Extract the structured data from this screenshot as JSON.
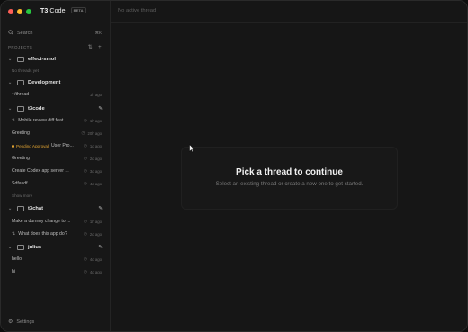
{
  "colors": {
    "close": "#fe5f57",
    "minimize": "#febc2e",
    "maximize": "#28c840",
    "pending": "#e2a432"
  },
  "app": {
    "title_brand": "T3",
    "title_rest": "Code",
    "badge": "BETA"
  },
  "search": {
    "label": "Search",
    "shortcut": "⌘K"
  },
  "projects_header": {
    "label": "PROJECTS"
  },
  "projects": [
    {
      "name": "effect-smol",
      "threads": [],
      "empty_text": "No threads yet"
    },
    {
      "name": "Development",
      "threads": [
        {
          "title": "~/thread",
          "time": "1h ago"
        }
      ]
    },
    {
      "name": "t3code",
      "threads": [
        {
          "title": "Mobile review diff feat...",
          "time": "1h ago",
          "branch": true
        },
        {
          "title": "Greeting",
          "time": "20h ago"
        },
        {
          "title": "User Pro...",
          "time": "1d ago",
          "pending": "Pending Approval"
        },
        {
          "title": "Greeting",
          "time": "2d ago"
        },
        {
          "title": "Create Codex app server ...",
          "time": "3d ago"
        },
        {
          "title": "Sdfasdf",
          "time": "4d ago"
        }
      ],
      "show_more": "Show more"
    },
    {
      "name": "t3chat",
      "threads": [
        {
          "title": "Make a dummy change to ...",
          "time": "1h ago"
        },
        {
          "title": "What does this app do?",
          "time": "2d ago",
          "branch": true
        }
      ]
    },
    {
      "name": "julius",
      "threads": [
        {
          "title": "hello",
          "time": "4d ago"
        },
        {
          "title": "hi",
          "time": "4d ago"
        }
      ]
    }
  ],
  "settings": {
    "label": "Settings"
  },
  "main": {
    "header": "No active thread",
    "empty_title": "Pick a thread to continue",
    "empty_subtitle": "Select an existing thread or create a new one to get started."
  }
}
